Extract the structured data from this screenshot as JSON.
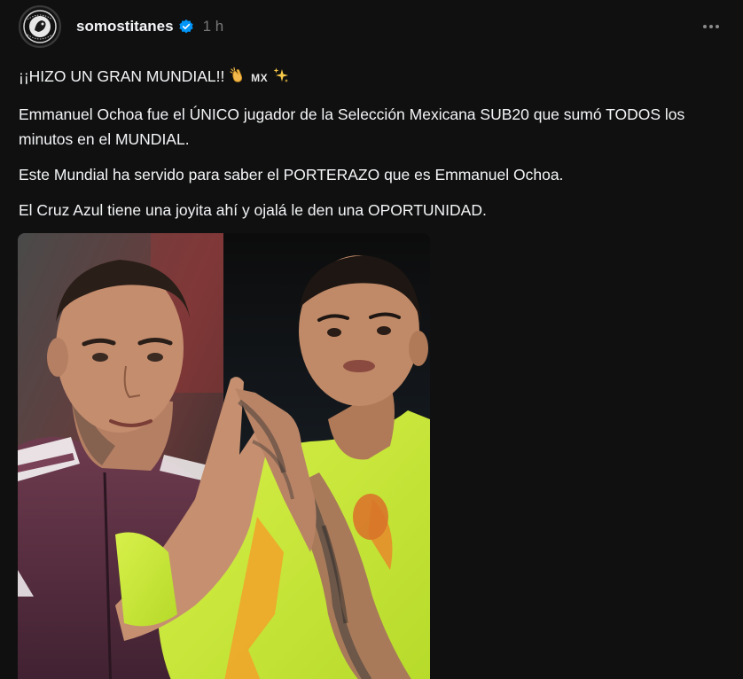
{
  "post": {
    "username": "somostitanes",
    "timestamp": "1 h",
    "avatar_icon": "titanes-logo",
    "verified_icon": "verified-badge-icon",
    "more_icon": "more-horizontal-icon",
    "headline_text": "¡¡HIZO UN GRAN MUNDIAL!!",
    "headline_flag": "MX",
    "paragraphs": [
      "Emmanuel Ochoa fue el ÚNICO jugador de la Selección Mexicana SUB20 que sumó TODOS los minutos en el MUNDIAL.",
      "Este Mundial ha servido para saber el PORTERAZO que es Emmanuel Ochoa.",
      "El Cruz Azul tiene una joyita ahí y ojalá le den una OPORTUNIDAD."
    ]
  },
  "colors": {
    "background": "#101010",
    "text": "#f3f5f7",
    "muted": "#777777",
    "verified": "#0095f6"
  }
}
